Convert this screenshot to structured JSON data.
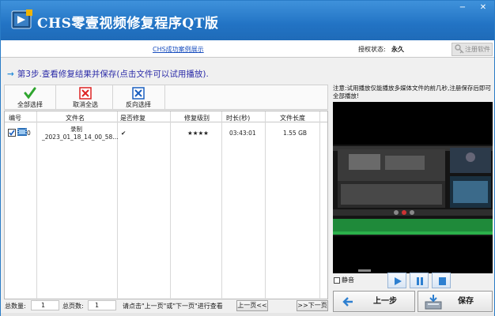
{
  "app": {
    "title": "CHS零壹视频修复程序QT版",
    "window_controls": {
      "minimize": "−",
      "close": "✕"
    }
  },
  "infobar": {
    "case_link": "CHS成功案例展示",
    "auth_label": "授权状态:",
    "auth_value": "永久",
    "register_button": "注册软件"
  },
  "step": {
    "text": "第3步.查看修复结果并保存(点击文件可以试用播放)."
  },
  "toolbar": {
    "select_all": "全部选择",
    "cancel_all": "取消全选",
    "invert": "反向选择"
  },
  "table": {
    "headers": [
      "编号",
      "文件名",
      "是否修复",
      "修复级别",
      "时长(秒)",
      "文件长度"
    ],
    "rows": [
      {
        "index": "0",
        "name_line1": "录制",
        "name_line2": "_2023_01_18_14_00_58...",
        "repaired": "✔",
        "level": "★★★★",
        "duration": "03:43:01",
        "size": "1.55 GB"
      }
    ]
  },
  "preview": {
    "note": "注意:试用播放仅能播放多媒体文件的前几秒,注册保存后即可全部播放!",
    "mute_label": "静音"
  },
  "pagination": {
    "total_label": "总数量:",
    "total_value": "1",
    "pages_label": "总页数:",
    "pages_value": "1",
    "hint": "请点击\"上一页\"或\"下一页\"进行查看",
    "prev": "上一页<<",
    "next": ">>下一页"
  },
  "actions": {
    "prev_step": "上一步",
    "save": "保存"
  },
  "colors": {
    "titlebar": "#2273c4",
    "accent": "#2b2ba8",
    "link": "#1a4fbf"
  }
}
